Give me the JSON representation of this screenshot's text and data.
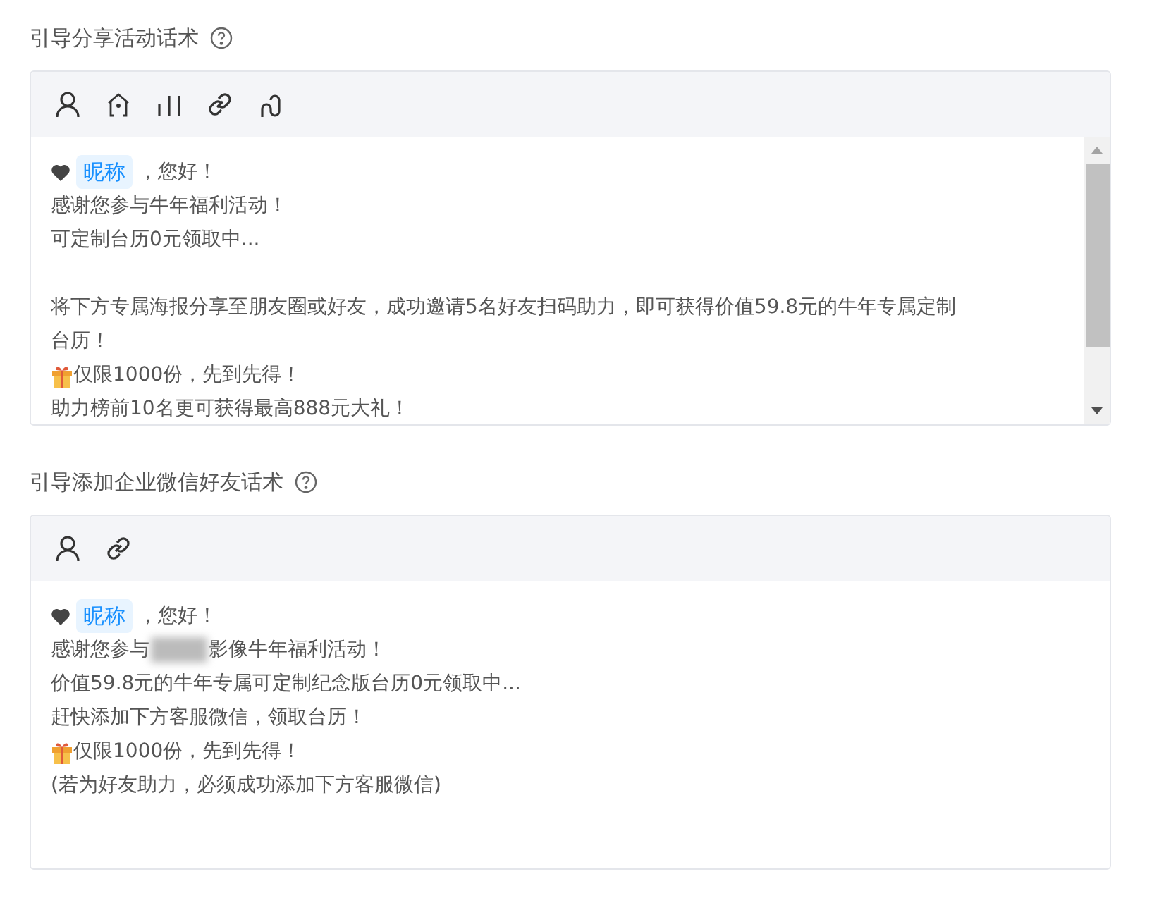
{
  "sections": [
    {
      "title": "引导分享活动话术",
      "toolbar": [
        {
          "kind": "person"
        },
        {
          "kind": "house"
        },
        {
          "kind": "bars"
        },
        {
          "kind": "link"
        },
        {
          "kind": "unlink"
        }
      ],
      "scrollable": true,
      "lines": [
        {
          "kind": "greeting",
          "tag": "昵称",
          "text": "，您好！"
        },
        {
          "kind": "text",
          "text": "感谢您参与牛年福利活动！"
        },
        {
          "kind": "text",
          "text": "可定制台历0元领取中..."
        },
        {
          "kind": "blank"
        },
        {
          "kind": "text",
          "text": "将下方专属海报分享至朋友圈或好友，成功邀请5名好友扫码助力，即可获得价值59.8元的牛年专属定制台历！"
        },
        {
          "kind": "gift",
          "text": "仅限1000份，先到先得！"
        },
        {
          "kind": "text",
          "text": "助力榜前10名更可获得最高888元大礼！"
        }
      ]
    },
    {
      "title": "引导添加企业微信好友话术",
      "toolbar": [
        {
          "kind": "person"
        },
        {
          "kind": "link"
        }
      ],
      "scrollable": false,
      "lines": [
        {
          "kind": "greeting",
          "tag": "昵称",
          "text": "，您好！"
        },
        {
          "kind": "redacted",
          "before": "感谢您参与",
          "after": "影像牛年福利活动！"
        },
        {
          "kind": "text",
          "text": "价值59.8元的牛年专属可定制纪念版台历0元领取中..."
        },
        {
          "kind": "text",
          "text": "赶快添加下方客服微信，领取台历！"
        },
        {
          "kind": "gift",
          "text": "仅限1000份，先到先得！"
        },
        {
          "kind": "text",
          "text": "(若为好友助力，必须成功添加下方客服微信)"
        }
      ]
    }
  ]
}
